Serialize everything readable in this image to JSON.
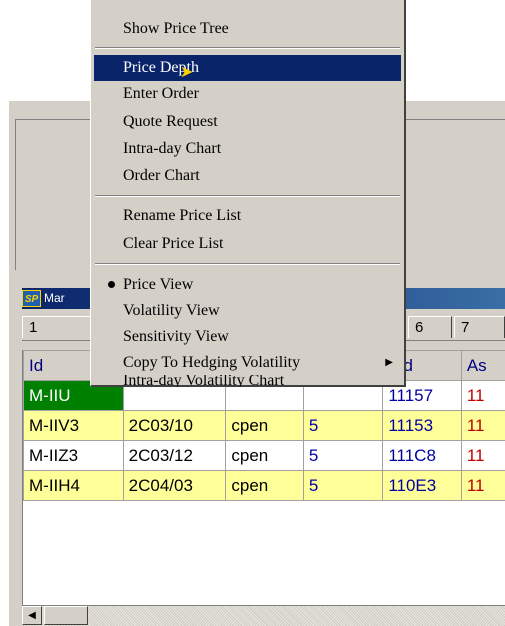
{
  "window": {
    "title": "Mar",
    "app_icon": "sp-icon"
  },
  "tabs": [
    "1",
    "6",
    "7"
  ],
  "columns": {
    "id": "Id",
    "bid": "Bid",
    "ask": "As"
  },
  "rows": [
    {
      "id": "M-IIU",
      "expiry": "",
      "status": "",
      "qty": "",
      "bid": "11157",
      "ask": "11",
      "style": "green"
    },
    {
      "id": "M-IIV3",
      "expiry": "2C03/10",
      "status": "cpen",
      "qty": "5",
      "bid": "11153",
      "ask": "11",
      "style": "yellow"
    },
    {
      "id": "M-IIZ3",
      "expiry": "2C03/12",
      "status": "cpen",
      "qty": "5",
      "bid": "111C8",
      "ask": "11",
      "style": "white"
    },
    {
      "id": "M-IIH4",
      "expiry": "2C04/03",
      "status": "cpen",
      "qty": "5",
      "bid": "110E3",
      "ask": "11",
      "style": "yellow"
    }
  ],
  "context_menu": {
    "show_price_tree": "Show Price Tree",
    "price_depth": "Price Depth",
    "enter_order": "Enter Order",
    "quote_request": "Quote Request",
    "intraday_chart": "Intra-day Chart",
    "order_chart": "Order Chart",
    "rename_price_list": "Rename Price List",
    "clear_price_list": "Clear Price List",
    "price_view": "Price View",
    "volatility_view": "Volatility View",
    "sensitivity_view": "Sensitivity View",
    "copy_to_hedging": "Copy To Hedging Volatility",
    "intraday_volatility_chart": "Intra-day Volatility Chart",
    "selected_item": "Price Depth",
    "checked_item": "Price View"
  },
  "colors": {
    "selection": "#0a246a",
    "title_bar": "#0a246a",
    "row_yellow": "#ffff99",
    "row_green": "#008000"
  }
}
